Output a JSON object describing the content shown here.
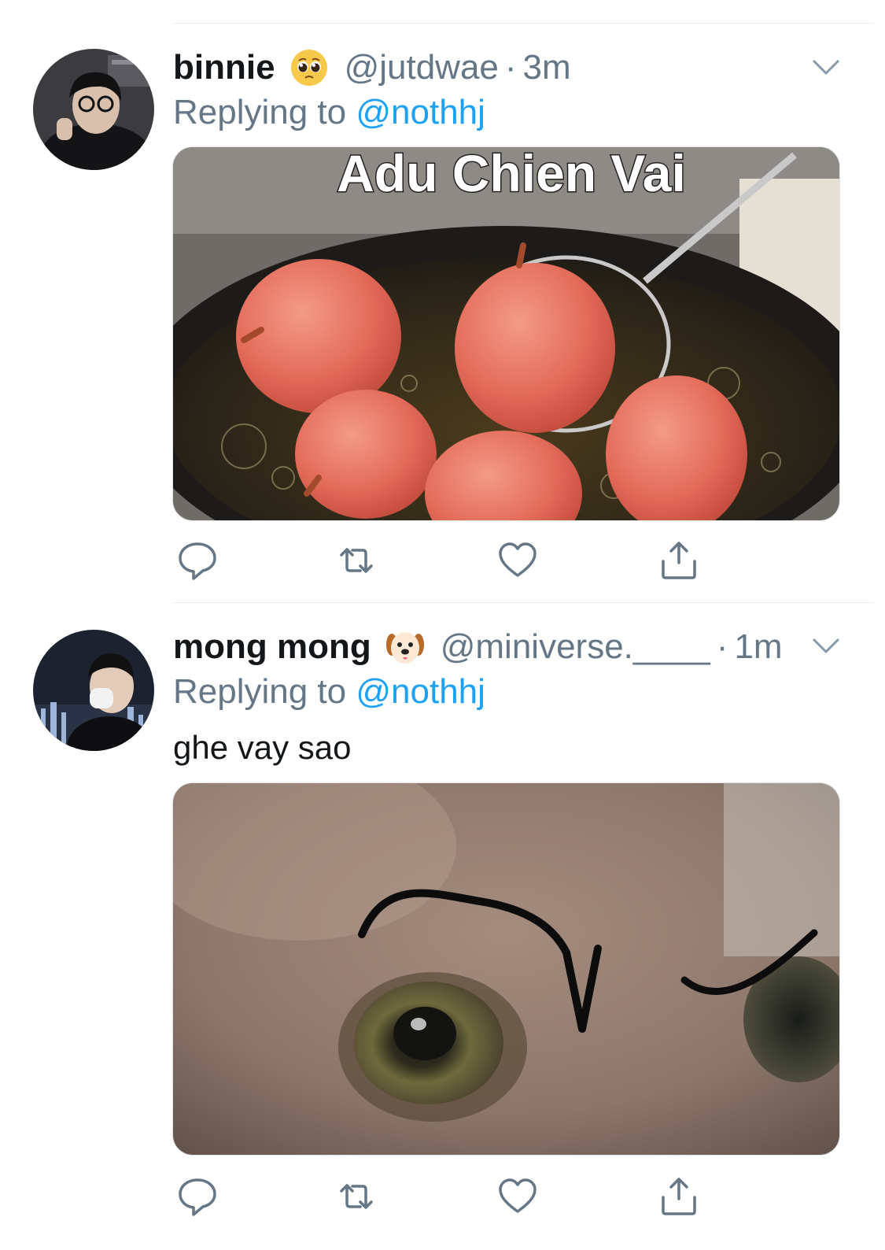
{
  "colors": {
    "text": "#14171a",
    "secondary": "#657786",
    "link": "#1da1f2",
    "divider": "#e6ecf0"
  },
  "tweets": [
    {
      "display_name": "binnie",
      "name_emoji": "pleading-face-emoji",
      "handle": "@jutdwae",
      "separator": "·",
      "time": "3m",
      "replying_prefix": "Replying to",
      "replying_to": "@nothhj",
      "text": "",
      "media_caption": "Adu Chien Vai"
    },
    {
      "display_name": "mong mong",
      "name_emoji": "dog-face-emoji",
      "handle": "@miniverse.____",
      "separator": "·",
      "time": "1m",
      "replying_prefix": "Replying to",
      "replying_to": "@nothhj",
      "text": "ghe vay sao",
      "media_caption": ""
    }
  ],
  "actions": [
    "reply-icon",
    "retweet-icon",
    "like-icon",
    "share-icon"
  ]
}
